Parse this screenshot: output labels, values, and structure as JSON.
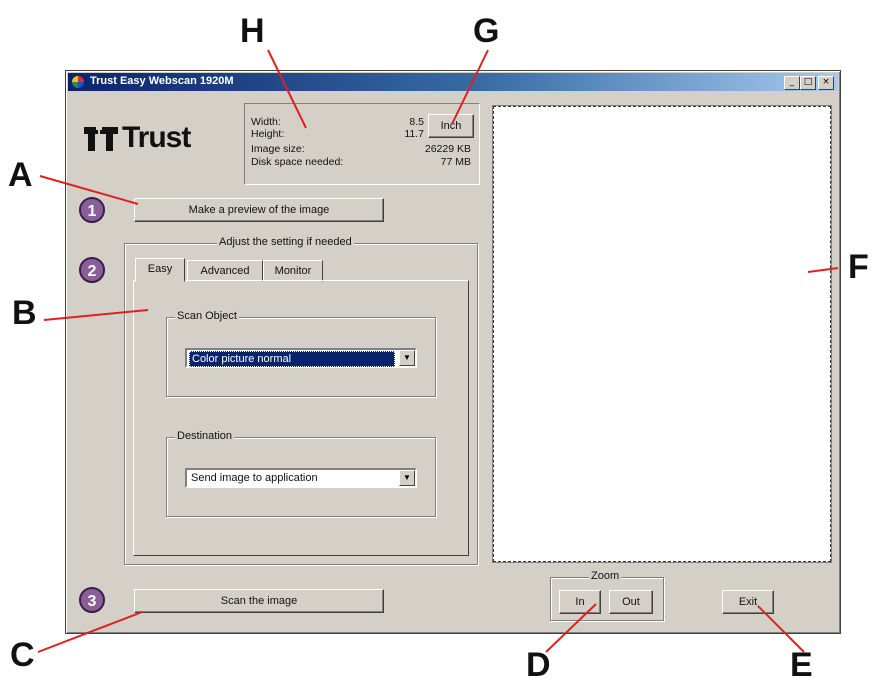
{
  "callouts": {
    "A": "A",
    "B": "B",
    "C": "C",
    "D": "D",
    "E": "E",
    "F": "F",
    "G": "G",
    "H": "H"
  },
  "window": {
    "title": "Trust Easy Webscan 1920M",
    "controls": {
      "minimize": "_",
      "maximize": "□",
      "close": "×"
    }
  },
  "logo": {
    "text": "Trust"
  },
  "info": {
    "width_label": "Width:",
    "width_value": "8.5",
    "height_label": "Height:",
    "height_value": "11.7",
    "image_size_label": "Image size:",
    "image_size_value": "26229 KB",
    "disk_label": "Disk space needed:",
    "disk_value": "77 MB",
    "unit_button": "Inch"
  },
  "steps": [
    "1",
    "2",
    "3"
  ],
  "preview_button": "Make a preview of the image",
  "settings": {
    "group_label": "Adjust the setting if needed",
    "tabs": [
      "Easy",
      "Advanced",
      "Monitor"
    ],
    "active_tab": "Easy",
    "scan_object": {
      "label": "Scan Object",
      "value": "Color picture normal"
    },
    "destination": {
      "label": "Destination",
      "value": "Send image to application"
    }
  },
  "scan_button": "Scan the image",
  "zoom": {
    "label": "Zoom",
    "in": "In",
    "out": "Out"
  },
  "exit_button": "Exit",
  "colors": {
    "titlebar": "#0a246a",
    "selection": "#0a246a",
    "face": "#d4d0c8",
    "step": "#8a5e98"
  }
}
